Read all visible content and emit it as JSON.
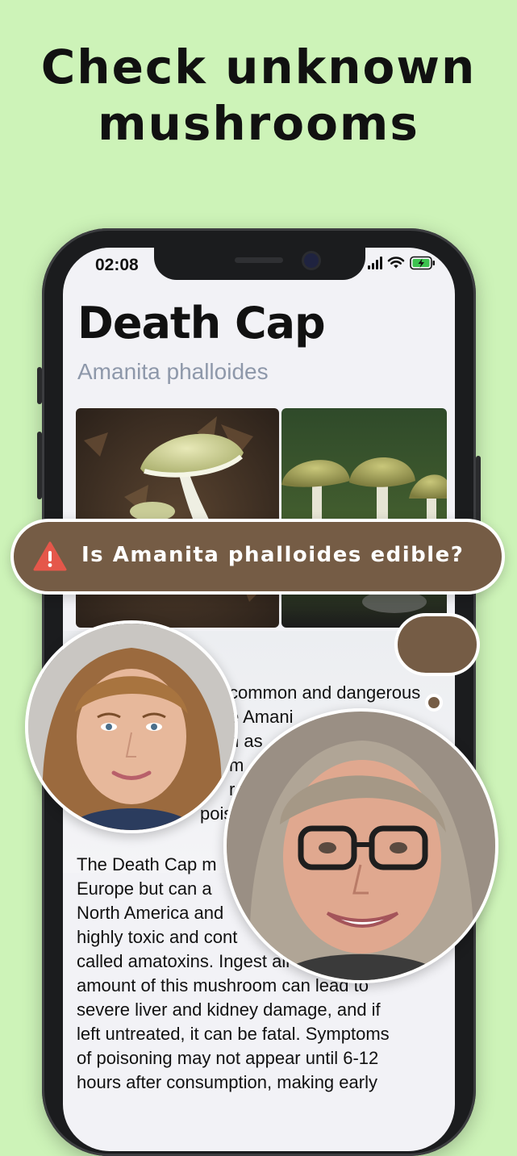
{
  "headline": {
    "line1": "Check unknown",
    "line2": "mushrooms"
  },
  "status_bar": {
    "time": "02:08"
  },
  "species": {
    "common_name": "Death Cap",
    "latin_name": "Amanita phalloides"
  },
  "description": {
    "partial_lines": [
      {
        "text": "common and dangerous"
      },
      {
        "text": "e Amani"
      },
      {
        "text": "n as"
      },
      {
        "text": "m"
      },
      {
        "text": "r th"
      },
      {
        "text": "poiso"
      }
    ],
    "paragraph2": [
      "The Death Cap m",
      "Europe but can a",
      "North America and",
      "highly toxic and cont",
      "called amatoxins. Ingest          all",
      "amount of this mushroom can lead to",
      "severe liver and kidney damage, and if",
      "left untreated, it can be fatal. Symptoms",
      "of poisoning may not appear until 6-12",
      "hours after consumption, making early"
    ]
  },
  "question_banner": {
    "text": "Is Amanita phalloides edible?",
    "icon": "warning-icon"
  },
  "colors": {
    "background": "#cdf3b8",
    "banner": "#755c45",
    "warning": "#e5574a",
    "subtitle": "#8e98aa"
  }
}
